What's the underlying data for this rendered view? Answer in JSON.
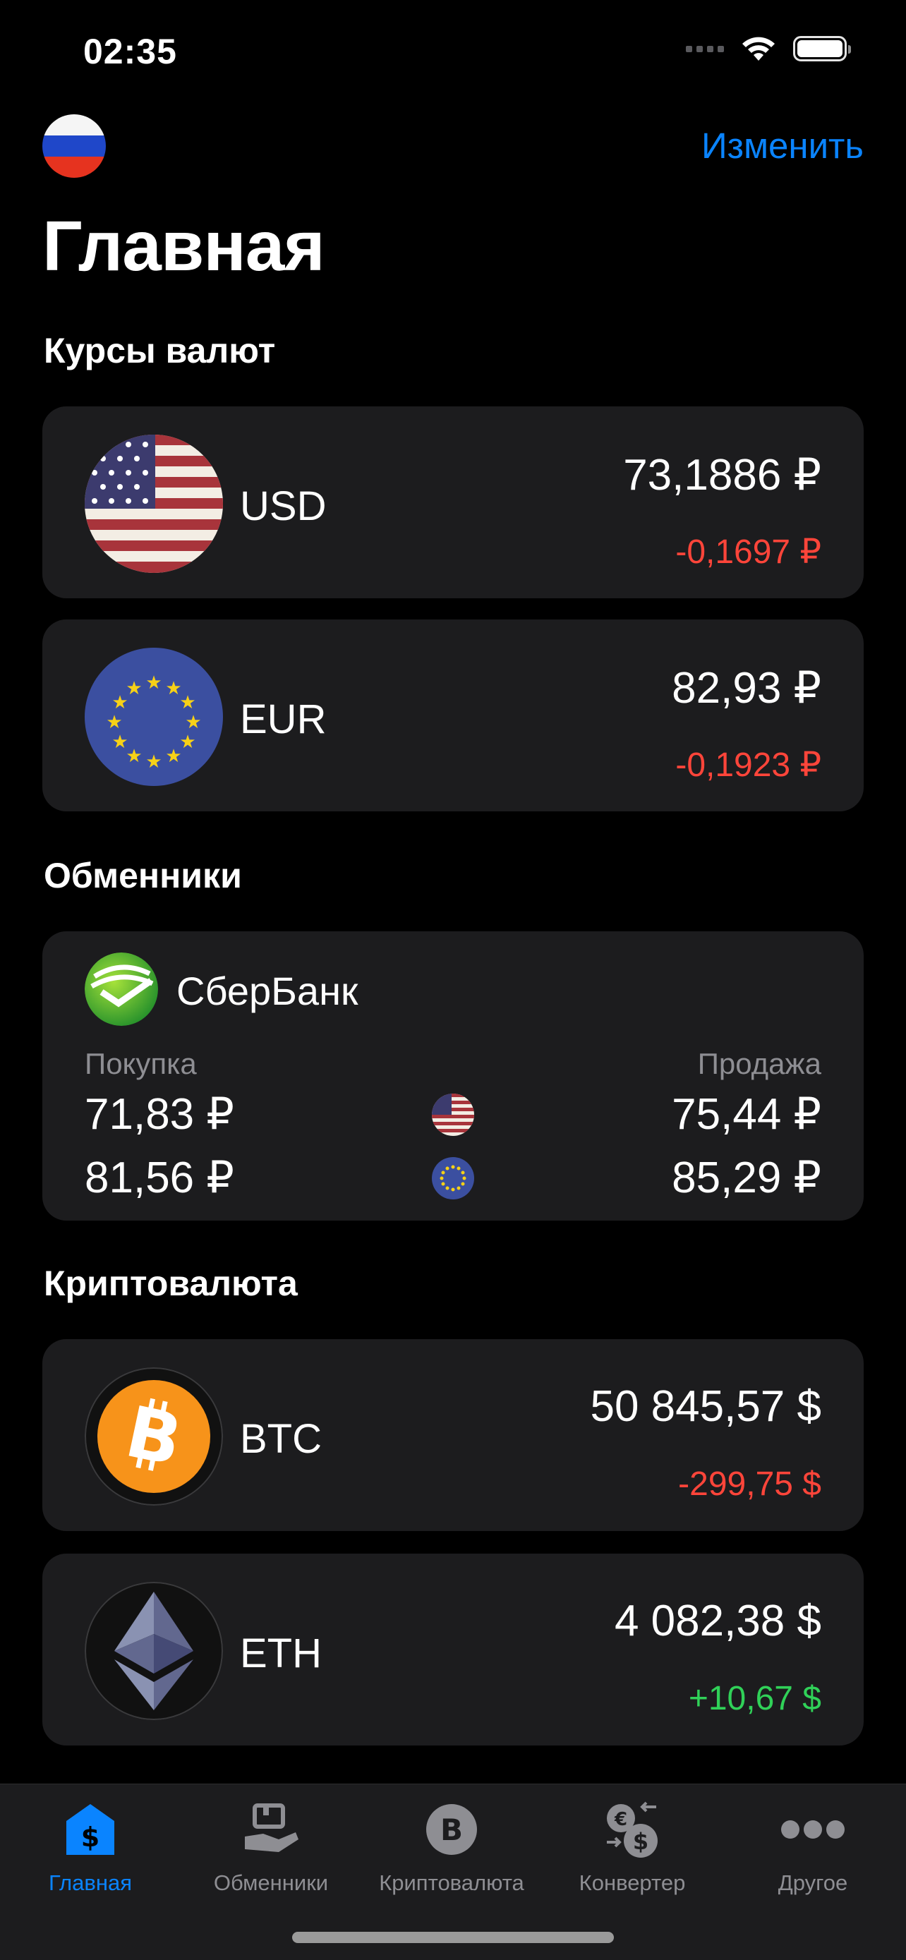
{
  "status_bar": {
    "time": "02:35"
  },
  "header": {
    "edit_label": "Изменить",
    "title": "Главная"
  },
  "colors": {
    "accent": "#0a84ff",
    "negative": "#ff453a",
    "positive": "#30d158",
    "card": "#1c1c1e"
  },
  "sections": {
    "rates": "Курсы валют",
    "exchangers": "Обменники",
    "crypto": "Криптовалюта"
  },
  "rates": [
    {
      "code": "USD",
      "icon": "us-flag-icon",
      "value": "73,1886 ₽",
      "change": "-0,1697 ₽"
    },
    {
      "code": "EUR",
      "icon": "eu-flag-icon",
      "value": "82,93 ₽",
      "change": "-0,1923 ₽"
    }
  ],
  "exchanger": {
    "name": "СберБанк",
    "icon": "sberbank-logo-icon",
    "buy_label": "Покупка",
    "sell_label": "Продажа",
    "rows": [
      {
        "currency_icon": "us-flag-icon",
        "buy": "71,83 ₽",
        "sell": "75,44 ₽"
      },
      {
        "currency_icon": "eu-flag-icon",
        "buy": "81,56 ₽",
        "sell": "85,29 ₽"
      }
    ]
  },
  "crypto": [
    {
      "code": "BTC",
      "icon": "bitcoin-icon",
      "value": "50 845,57 $",
      "change": "-299,75 $"
    },
    {
      "code": "ETH",
      "icon": "ethereum-icon",
      "value": "4 082,38 $",
      "change": "+10,67 $"
    }
  ],
  "tabs": [
    {
      "label": "Главная",
      "icon": "home-dollar-icon",
      "active": true
    },
    {
      "label": "Обменники",
      "icon": "exchanger-hand-icon",
      "active": false
    },
    {
      "label": "Криптовалюта",
      "icon": "bitcoin-circle-icon",
      "active": false
    },
    {
      "label": "Конвертер",
      "icon": "converter-icon",
      "active": false
    },
    {
      "label": "Другое",
      "icon": "more-dots-icon",
      "active": false
    }
  ]
}
